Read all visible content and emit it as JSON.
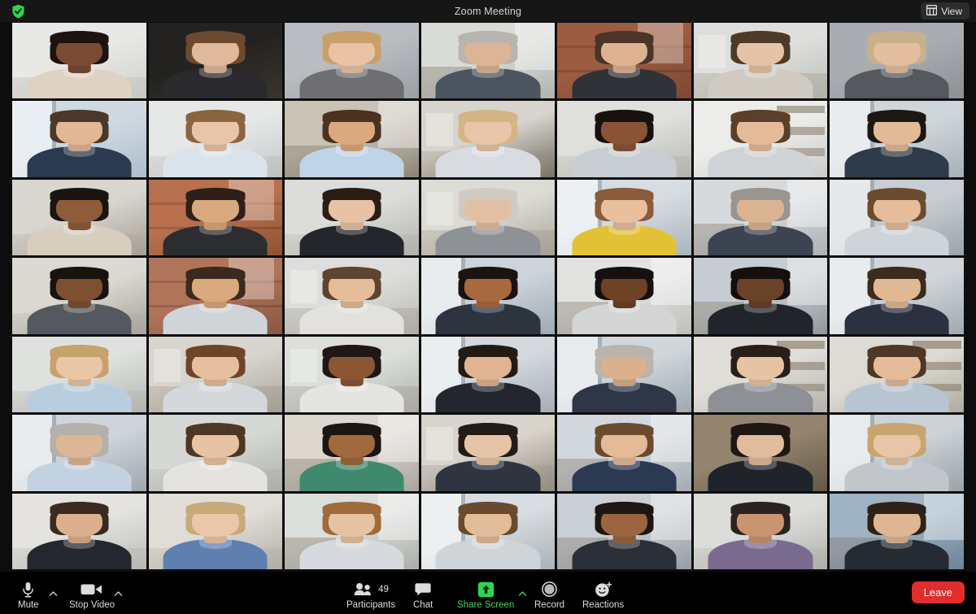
{
  "titlebar": {
    "security_icon": "shield-check-icon",
    "title": "Zoom Meeting",
    "view_button": {
      "icon": "grid-view-icon",
      "label": "View"
    }
  },
  "toolbar": {
    "mute": {
      "icon": "microphone-icon",
      "label": "Mute",
      "has_chevron": true
    },
    "video": {
      "icon": "camera-icon",
      "label": "Stop Video",
      "has_chevron": true
    },
    "participants": {
      "icon": "participants-icon",
      "label": "Participants",
      "count": "49"
    },
    "chat": {
      "icon": "chat-bubble-icon",
      "label": "Chat"
    },
    "share_screen": {
      "icon": "share-screen-arrow-icon",
      "label": "Share Screen",
      "has_chevron": true,
      "color": "#4ad05a"
    },
    "record": {
      "icon": "record-circle-icon",
      "label": "Record"
    },
    "reactions": {
      "icon": "smiley-plus-icon",
      "label": "Reactions"
    },
    "leave": {
      "label": "Leave",
      "color": "#e02d2d"
    }
  },
  "grid": {
    "columns": 7,
    "rows": 7,
    "active_speaker_index": 9,
    "active_border_color": "#c8d64a",
    "tiles": [
      {
        "skin": "#7a4a33",
        "hair": "#1d1410",
        "shirt": "#ded2c2",
        "bg1": "#e8e8e6",
        "bg2": "#cfd2cc",
        "scene": "bright-room"
      },
      {
        "skin": "#e0b89a",
        "hair": "#6d4a2f",
        "shirt": "#2a2a2c",
        "bg1": "#2e2b28",
        "bg2": "#48423c",
        "scene": "dark-wall"
      },
      {
        "skin": "#e8c3a4",
        "hair": "#c9a06a",
        "shirt": "#6f6f72",
        "bg1": "#b9bcc0",
        "bg2": "#9aa0a4",
        "scene": "gray-wall"
      },
      {
        "skin": "#dcb596",
        "hair": "#b9b4ae",
        "shirt": "#4a5560",
        "bg1": "#d9dbd6",
        "bg2": "#b0b4ad",
        "scene": "office"
      },
      {
        "skin": "#dfb391",
        "hair": "#4a3526",
        "shirt": "#2f3338",
        "bg1": "#9b5c42",
        "bg2": "#7d4832",
        "scene": "brick"
      },
      {
        "skin": "#e6c2a6",
        "hair": "#4e3a29",
        "shirt": "#cfcac2",
        "bg1": "#dedfdc",
        "bg2": "#bcbfba",
        "scene": "living-room"
      },
      {
        "skin": "#e4bf9f",
        "hair": "#c8b18a",
        "shirt": "#55585c",
        "bg1": "#a9adb1",
        "bg2": "#8b9094",
        "scene": "gray-wall"
      },
      {
        "skin": "#e2b795",
        "hair": "#4a3828",
        "shirt": "#2b3a4e",
        "bg1": "#cfd9e2",
        "bg2": "#aebdcc",
        "scene": "window"
      },
      {
        "skin": "#e8c4a8",
        "hair": "#8a6540",
        "shirt": "#dbe3ea",
        "bg1": "#e6e8e8",
        "bg2": "#c5c9c9",
        "scene": "bright-room"
      },
      {
        "skin": "#dca97f",
        "hair": "#4b3220",
        "shirt": "#bfd4e6",
        "bg1": "#c9c3b6",
        "bg2": "#8d8374",
        "scene": "office"
      },
      {
        "skin": "#e9c6a9",
        "hair": "#d3b684",
        "shirt": "#d8dce0",
        "bg1": "#d7d4cd",
        "bg2": "#6f6a60",
        "scene": "living-room"
      },
      {
        "skin": "#8a5335",
        "hair": "#17120e",
        "shirt": "#c8cdd2",
        "bg1": "#dfe0dd",
        "bg2": "#b6b9b4",
        "scene": "bright-room"
      },
      {
        "skin": "#e4bb98",
        "hair": "#5a3f29",
        "shirt": "#cfd3d6",
        "bg1": "#ececea",
        "bg2": "#cbccc7",
        "scene": "shelf"
      },
      {
        "skin": "#e2bb96",
        "hair": "#1c1712",
        "shirt": "#2f3a4a",
        "bg1": "#cfd6db",
        "bg2": "#a7b0b7",
        "scene": "window"
      },
      {
        "skin": "#8f5c3a",
        "hair": "#1b1411",
        "shirt": "#d8cec0",
        "bg1": "#d9d6cf",
        "bg2": "#a59f95",
        "scene": "bright-room"
      },
      {
        "skin": "#d9a87c",
        "hair": "#2e2018",
        "shirt": "#2b2d31",
        "bg1": "#b8704e",
        "bg2": "#8d5334",
        "scene": "brick"
      },
      {
        "skin": "#e7c2a4",
        "hair": "#2b1d14",
        "shirt": "#23262b",
        "bg1": "#dcddda",
        "bg2": "#b4b6b2",
        "scene": "bright-room"
      },
      {
        "skin": "#e3c0a4",
        "hair": "#cfcac2",
        "shirt": "#8e9296",
        "bg1": "#dcdbd4",
        "bg2": "#a9a79e",
        "scene": "living-room"
      },
      {
        "skin": "#e8c0a0",
        "hair": "#8a5c3a",
        "shirt": "#e2c234",
        "bg1": "#d6dde2",
        "bg2": "#aab4bc",
        "scene": "window"
      },
      {
        "skin": "#dcb491",
        "hair": "#9a9590",
        "shirt": "#3b4450",
        "bg1": "#d7dadd",
        "bg2": "#aab0b5",
        "scene": "office"
      },
      {
        "skin": "#e5bd9b",
        "hair": "#6b4b2e",
        "shirt": "#cfd4d8",
        "bg1": "#c8ced3",
        "bg2": "#9aa3ab",
        "scene": "window"
      },
      {
        "skin": "#7e4f30",
        "hair": "#191310",
        "shirt": "#54595f",
        "bg1": "#dcd9d2",
        "bg2": "#a8a49b",
        "scene": "bright-room"
      },
      {
        "skin": "#dba87c",
        "hair": "#3a2a1d",
        "shirt": "#cfd4d9",
        "bg1": "#b0745a",
        "bg2": "#8a5640",
        "scene": "brick"
      },
      {
        "skin": "#e5bd9b",
        "hair": "#5e4530",
        "shirt": "#e3e1dc",
        "bg1": "#dddedb",
        "bg2": "#b7b8b4",
        "scene": "living-room"
      },
      {
        "skin": "#a9693f",
        "hair": "#1a1310",
        "shirt": "#2c3440",
        "bg1": "#ccd4da",
        "bg2": "#9fa9b1",
        "scene": "window"
      },
      {
        "skin": "#6e4226",
        "hair": "#161110",
        "shirt": "#d3d6d4",
        "bg1": "#e2e3e0",
        "bg2": "#bdbfbb",
        "scene": "office"
      },
      {
        "skin": "#6b4128",
        "hair": "#150f0d",
        "shirt": "#21252b",
        "bg1": "#c6ccd1",
        "bg2": "#8f979e",
        "scene": "office"
      },
      {
        "skin": "#e1b894",
        "hair": "#3b2b1f",
        "shirt": "#2a3140",
        "bg1": "#cfd5da",
        "bg2": "#a1a9b0",
        "scene": "window"
      },
      {
        "skin": "#e9c6a6",
        "hair": "#c6a36a",
        "shirt": "#b9cde0",
        "bg1": "#dfe1de",
        "bg2": "#b6b8b4",
        "scene": "bright-room"
      },
      {
        "skin": "#e6bf9e",
        "hair": "#6e4527",
        "shirt": "#d4d8dc",
        "bg1": "#d8d5ce",
        "bg2": "#a8a59c",
        "scene": "living-room"
      },
      {
        "skin": "#8b5634",
        "hair": "#201714",
        "shirt": "#e6e4e0",
        "bg1": "#dcdedb",
        "bg2": "#b0b2ae",
        "scene": "living-room"
      },
      {
        "skin": "#e0b391",
        "hair": "#241a14",
        "shirt": "#23262c",
        "bg1": "#d3d9de",
        "bg2": "#a5adb4",
        "scene": "window"
      },
      {
        "skin": "#dcb08c",
        "hair": "#b9b4ae",
        "shirt": "#2d3748",
        "bg1": "#cfd6dc",
        "bg2": "#9fa8b0",
        "scene": "window"
      },
      {
        "skin": "#e6c3a3",
        "hair": "#2a1f18",
        "shirt": "#8d9196",
        "bg1": "#e0ded8",
        "bg2": "#b4b2ab",
        "scene": "shelf"
      },
      {
        "skin": "#e3bb99",
        "hair": "#4f3724",
        "shirt": "#b7c5d2",
        "bg1": "#dedbd4",
        "bg2": "#aeaaa1",
        "scene": "shelf"
      },
      {
        "skin": "#dcb796",
        "hair": "#b5b0aa",
        "shirt": "#c3d2e0",
        "bg1": "#cdd4da",
        "bg2": "#9fa7ae",
        "scene": "window"
      },
      {
        "skin": "#e8c3a3",
        "hair": "#4e3724",
        "shirt": "#e4e3e0",
        "bg1": "#d6d8d5",
        "bg2": "#aeb0ac",
        "scene": "bright-room"
      },
      {
        "skin": "#a06a3e",
        "hair": "#1d1512",
        "shirt": "#3f8a6e",
        "bg1": "#dcd8d0",
        "bg2": "#a9a59c",
        "scene": "office"
      },
      {
        "skin": "#e6c5a6",
        "hair": "#241b15",
        "shirt": "#2e3440",
        "bg1": "#d8d4cc",
        "bg2": "#8f8a80",
        "scene": "living-room"
      },
      {
        "skin": "#e4bb98",
        "hair": "#6b4b2e",
        "shirt": "#2b3a52",
        "bg1": "#d2d8dd",
        "bg2": "#a3abb2",
        "scene": "office"
      },
      {
        "skin": "#e0bc9c",
        "hair": "#1e1714",
        "shirt": "#1f242c",
        "bg1": "#b9a68a",
        "bg2": "#7d6e58",
        "scene": "dark-wall"
      },
      {
        "skin": "#e8c5a6",
        "hair": "#c9a46e",
        "shirt": "#c1c6cb",
        "bg1": "#cbd2d8",
        "bg2": "#9aa3aa",
        "scene": "window"
      },
      {
        "skin": "#dcb08d",
        "hair": "#3a2a20",
        "shirt": "#24282e",
        "bg1": "#e4e3e0",
        "bg2": "#bcbcb8",
        "scene": "bright-room"
      },
      {
        "skin": "#e9c7a8",
        "hair": "#c8a979",
        "shirt": "#5e7fb0",
        "bg1": "#e0ddd6",
        "bg2": "#b2afa7",
        "scene": "bright-room"
      },
      {
        "skin": "#e6c3a2",
        "hair": "#a06a3a",
        "shirt": "#d6d9dd",
        "bg1": "#dcdedb",
        "bg2": "#abada9",
        "scene": "office"
      },
      {
        "skin": "#e2bb98",
        "hair": "#6a4a2e",
        "shirt": "#cfd4d9",
        "bg1": "#d8dde1",
        "bg2": "#aab1b7",
        "scene": "window"
      },
      {
        "skin": "#9c6540",
        "hair": "#1e1613",
        "shirt": "#2b3038",
        "bg1": "#c9cfd4",
        "bg2": "#959da4",
        "scene": "office"
      },
      {
        "skin": "#c99470",
        "hair": "#2a2320",
        "shirt": "#7b6a8f",
        "bg1": "#dcddda",
        "bg2": "#b1b2ae",
        "scene": "bright-room"
      },
      {
        "skin": "#dfb693",
        "hair": "#2e2218",
        "shirt": "#252a33",
        "bg1": "#9fb3c4",
        "bg2": "#6d8396",
        "scene": "office"
      }
    ]
  }
}
